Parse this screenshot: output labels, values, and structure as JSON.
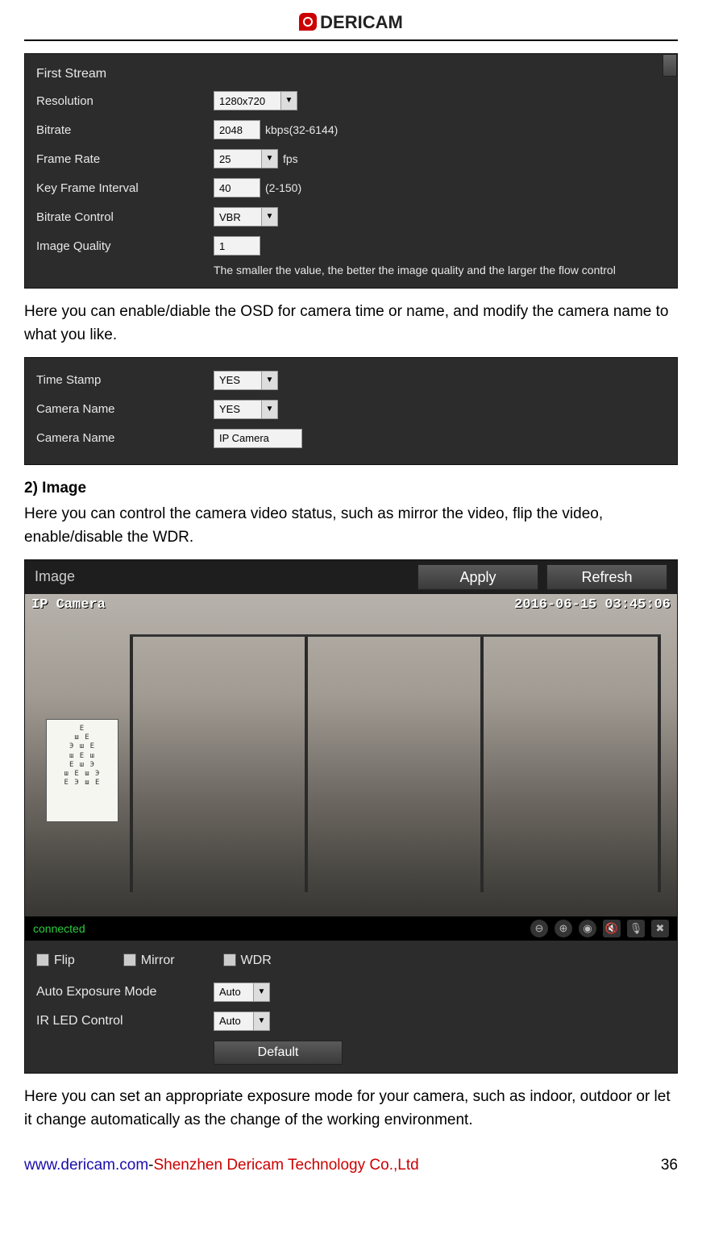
{
  "header": {
    "brand": "DERICAM"
  },
  "stream": {
    "title": "First Stream",
    "rows": {
      "resolution_label": "Resolution",
      "resolution_value": "1280x720",
      "bitrate_label": "Bitrate",
      "bitrate_value": "2048",
      "bitrate_hint": "kbps(32-6144)",
      "framerate_label": "Frame Rate",
      "framerate_value": "25",
      "framerate_unit": "fps",
      "keyframe_label": "Key Frame Interval",
      "keyframe_value": "40",
      "keyframe_hint": "(2-150)",
      "brcontrol_label": "Bitrate Control",
      "brcontrol_value": "VBR",
      "imgquality_label": "Image Quality",
      "imgquality_value": "1",
      "imgquality_helper": "The smaller the value, the better the image quality and the larger the flow control"
    }
  },
  "doc": {
    "osd_text": "Here you can enable/diable the OSD for camera time or name, and modify the camera name to what you like.",
    "sec2_heading": "2) Image",
    "sec2_text": "Here you can control the camera video status, such as mirror the video, flip the video, enable/disable the WDR.",
    "exposure_text": "Here you can set an appropriate exposure mode for your camera, such as indoor, outdoor or let it change automatically as the change of the working environment."
  },
  "osd": {
    "timestamp_label": "Time Stamp",
    "timestamp_value": "YES",
    "camname_sel_label": "Camera Name",
    "camname_sel_value": "YES",
    "camname_txt_label": "Camera Name",
    "camname_txt_value": "IP Camera"
  },
  "image": {
    "title": "Image",
    "apply_btn": "Apply",
    "refresh_btn": "Refresh",
    "overlay_name": "IP Camera",
    "overlay_time": "2016-06-15 03:45:06",
    "eye_chart_lines": "E\nш E\nЭ ш E\nш E ш\nE ш Э\nш E ш Э\nE Э ш E",
    "status": "connected",
    "flip_label": "Flip",
    "mirror_label": "Mirror",
    "wdr_label": "WDR",
    "aemode_label": "Auto Exposure Mode",
    "aemode_value": "Auto",
    "irled_label": "IR LED Control",
    "irled_value": "Auto",
    "default_btn": "Default"
  },
  "footer": {
    "url": "www.dericam.com",
    "sep": "-",
    "company": "Shenzhen Dericam Technology Co.,Ltd",
    "page": "36"
  }
}
